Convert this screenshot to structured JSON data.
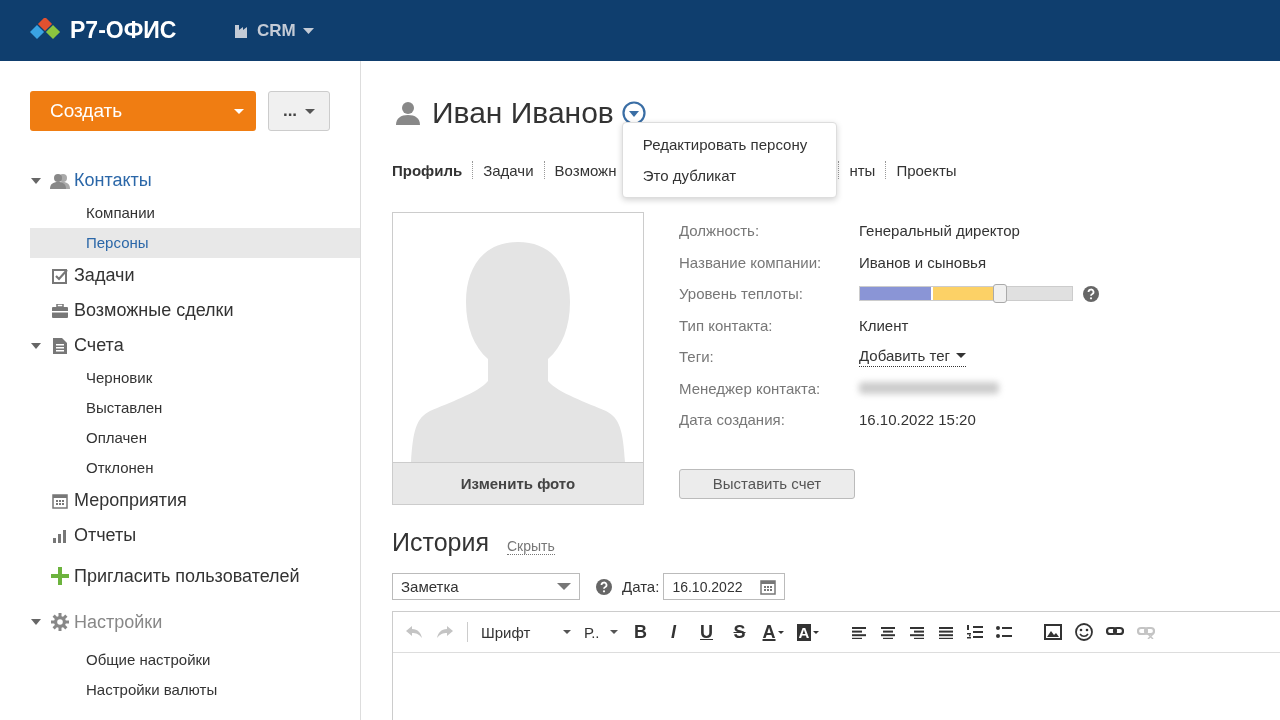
{
  "header": {
    "logo": "Р7-ОФИС",
    "module": "CRM"
  },
  "sidebar": {
    "create_button": "Создать",
    "more_button": "...",
    "items": [
      {
        "label": "Контакты",
        "active": true,
        "dimmed": false,
        "expanded": true,
        "children": [
          {
            "label": "Компании",
            "selected": false
          },
          {
            "label": "Персоны",
            "selected": true
          }
        ]
      },
      {
        "label": "Задачи",
        "active": false,
        "dimmed": false
      },
      {
        "label": "Возможные сделки",
        "active": false,
        "dimmed": false
      },
      {
        "label": "Счета",
        "active": false,
        "dimmed": false,
        "expanded": true,
        "children": [
          {
            "label": "Черновик",
            "selected": false
          },
          {
            "label": "Выставлен",
            "selected": false
          },
          {
            "label": "Оплачен",
            "selected": false
          },
          {
            "label": "Отклонен",
            "selected": false
          }
        ]
      },
      {
        "label": "Мероприятия",
        "active": false,
        "dimmed": false
      },
      {
        "label": "Отчеты",
        "active": false,
        "dimmed": false
      },
      {
        "label": "Пригласить пользователей",
        "active": false,
        "dimmed": false
      },
      {
        "label": "Настройки",
        "active": false,
        "dimmed": true,
        "expanded": true,
        "children": [
          {
            "label": "Общие настройки",
            "selected": false
          },
          {
            "label": "Настройки валюты",
            "selected": false
          }
        ]
      }
    ]
  },
  "person": {
    "name": "Иван Иванов",
    "menu": [
      "Редактировать персону",
      "Это дубликат"
    ],
    "tabs": [
      {
        "label": "Профиль",
        "selected": true
      },
      {
        "label": "Задачи",
        "selected": false
      },
      {
        "label": "Возможн",
        "selected": false
      },
      {
        "label": "нты",
        "selected": false
      },
      {
        "label": "Проекты",
        "selected": false
      }
    ],
    "photo_button": "Изменить фото",
    "fields": [
      {
        "label": "Должность:",
        "kind": "text",
        "value": "Генеральный директор"
      },
      {
        "label": "Название компании:",
        "kind": "text",
        "value": "Иванов и сыновья"
      },
      {
        "label": "Уровень теплоты:",
        "kind": "heat",
        "level": 0.66
      },
      {
        "label": "Тип контакта:",
        "kind": "text",
        "value": "Клиент"
      },
      {
        "label": "Теги:",
        "kind": "tag",
        "value": "Добавить тег"
      },
      {
        "label": "Менеджер контакта:",
        "kind": "blurred"
      },
      {
        "label": "Дата создания:",
        "kind": "text",
        "value": "16.10.2022 15:20"
      }
    ],
    "invoice_button": "Выставить счет"
  },
  "history": {
    "title": "История",
    "hide_link": "Скрыть",
    "type_select": "Заметка",
    "date_label": "Дата:",
    "date_value": "16.10.2022",
    "toolbar": [
      {
        "kind": "undo",
        "disabled": true
      },
      {
        "kind": "redo",
        "disabled": true
      },
      {
        "kind": "sep"
      },
      {
        "kind": "select",
        "text": "Шрифт"
      },
      {
        "kind": "select",
        "text": "Р.."
      },
      {
        "kind": "bold",
        "text": "B"
      },
      {
        "kind": "italic",
        "text": "I"
      },
      {
        "kind": "underline",
        "text": "U"
      },
      {
        "kind": "strike",
        "text": "S"
      },
      {
        "kind": "text-color",
        "text": "A"
      },
      {
        "kind": "highlight",
        "text": "A"
      },
      {
        "kind": "gap"
      },
      {
        "kind": "align-left"
      },
      {
        "kind": "align-center"
      },
      {
        "kind": "align-right"
      },
      {
        "kind": "align-justify"
      },
      {
        "kind": "olist"
      },
      {
        "kind": "ulist"
      },
      {
        "kind": "gap"
      },
      {
        "kind": "image"
      },
      {
        "kind": "smiley"
      },
      {
        "kind": "link",
        "disabled": false
      },
      {
        "kind": "unlink",
        "disabled": true
      }
    ]
  }
}
